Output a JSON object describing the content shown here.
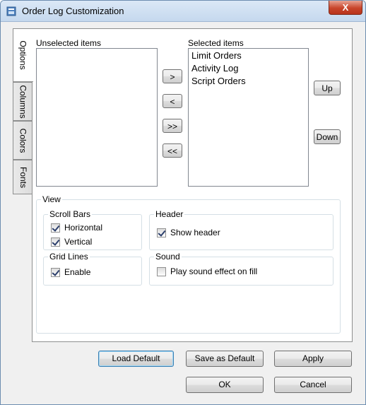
{
  "window": {
    "title": "Order Log Customization",
    "close_glyph": "X"
  },
  "tabs": [
    {
      "label": "Options",
      "active": true
    },
    {
      "label": "Columns",
      "active": false
    },
    {
      "label": "Colors",
      "active": false
    },
    {
      "label": "Fonts",
      "active": false
    }
  ],
  "options": {
    "unselected_label": "Unselected items",
    "unselected_items": [],
    "selected_label": "Selected items",
    "selected_items": [
      "Limit Orders",
      "Activity Log",
      "Script Orders"
    ],
    "move_buttons": {
      "add": ">",
      "remove": "<",
      "add_all": ">>",
      "remove_all": "<<"
    },
    "order_buttons": {
      "up": "Up",
      "down": "Down"
    },
    "view": {
      "title": "View",
      "scroll_bars": {
        "title": "Scroll Bars",
        "horizontal": {
          "label": "Horizontal",
          "checked": true
        },
        "vertical": {
          "label": "Vertical",
          "checked": true
        }
      },
      "header": {
        "title": "Header",
        "show_header": {
          "label": "Show header",
          "checked": true
        }
      },
      "grid_lines": {
        "title": "Grid Lines",
        "enable": {
          "label": "Enable",
          "checked": true
        }
      },
      "sound": {
        "title": "Sound",
        "play_sound": {
          "label": "Play sound effect on fill",
          "checked": false
        }
      }
    }
  },
  "footer": {
    "load_default": "Load Default",
    "save_as_default": "Save as Default",
    "apply": "Apply",
    "ok": "OK",
    "cancel": "Cancel"
  }
}
